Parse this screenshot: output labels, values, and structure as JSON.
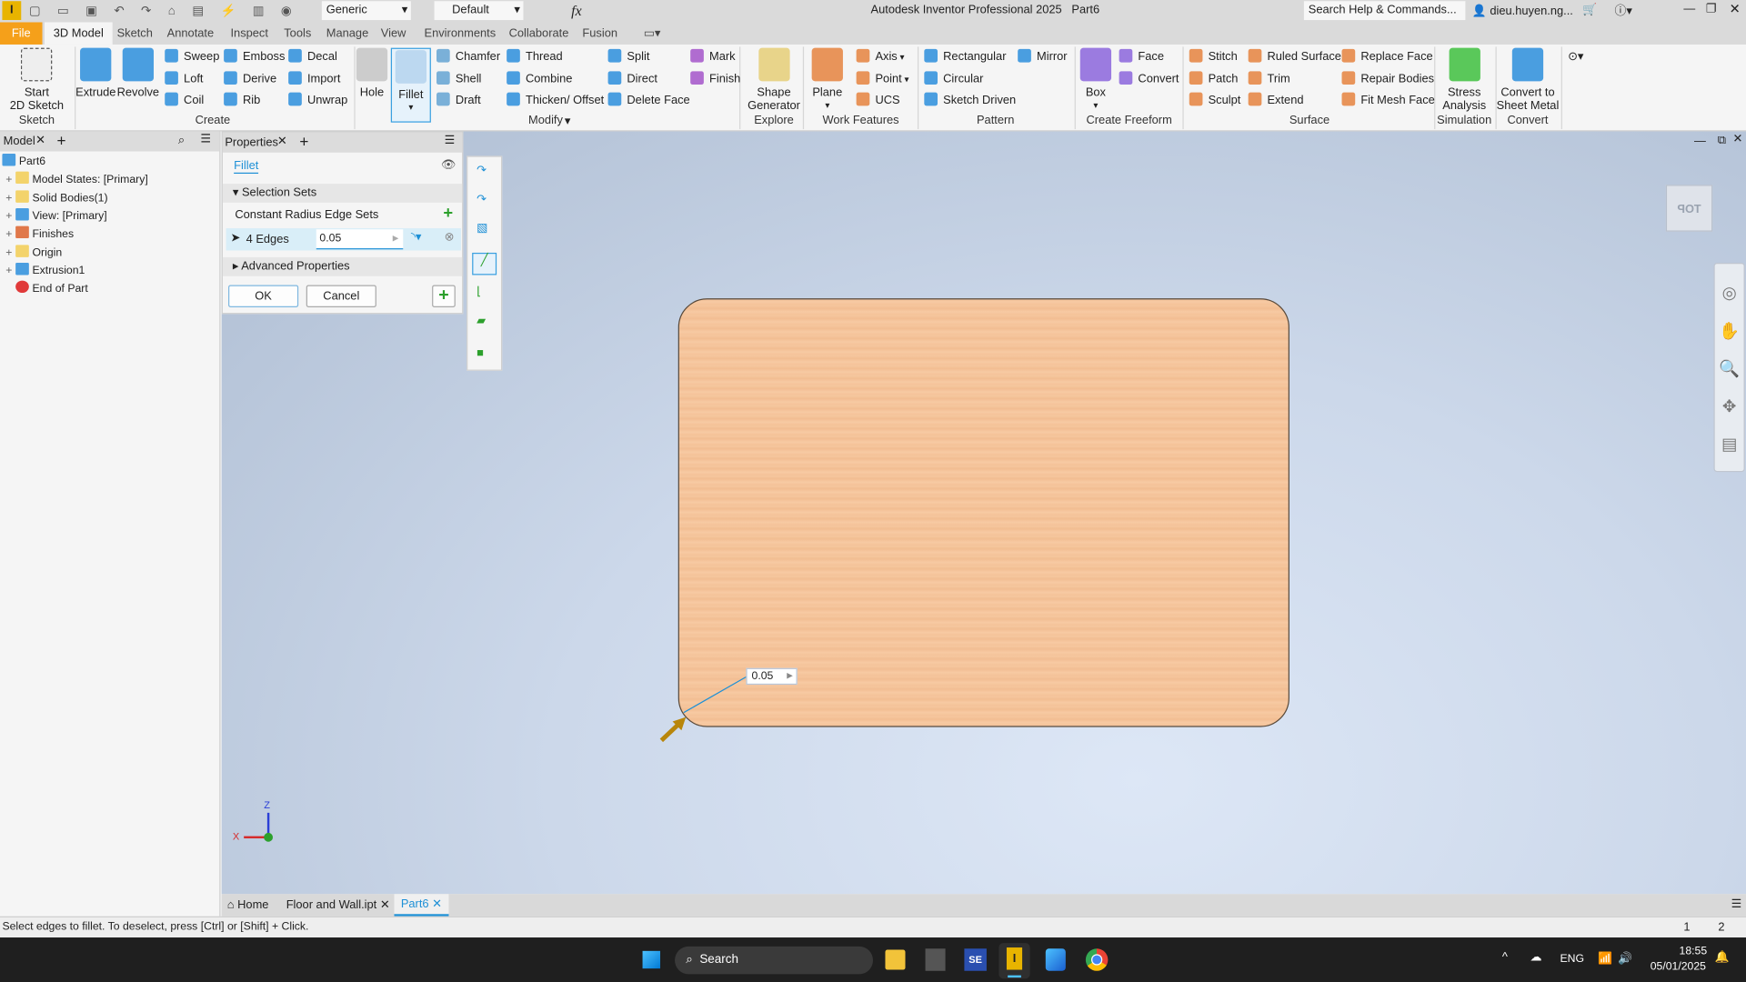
{
  "app": {
    "title": "Autodesk Inventor Professional 2025",
    "document": "Part6",
    "search_placeholder": "Search Help & Commands...",
    "user": "dieu.huyen.ng...",
    "material": "Generic",
    "appearance": "Default"
  },
  "ribbon_tabs": [
    "File",
    "3D Model",
    "Sketch",
    "Annotate",
    "Inspect",
    "Tools",
    "Manage",
    "View",
    "Environments",
    "Collaborate",
    "Fusion"
  ],
  "ribbon": {
    "groups": [
      "Sketch",
      "Create",
      "Modify",
      "Explore",
      "Work Features",
      "Pattern",
      "Create Freeform",
      "Surface",
      "Simulation",
      "Convert"
    ],
    "large": [
      "Start\n2D Sketch",
      "Extrude",
      "Revolve",
      "Hole",
      "Fillet",
      "Shape\nGenerator",
      "Plane",
      "Box",
      "Stress\nAnalysis",
      "Convert to\nSheet Metal"
    ],
    "small": [
      "Sweep",
      "Loft",
      "Coil",
      "Emboss",
      "Derive",
      "Rib",
      "Decal",
      "Import",
      "Unwrap",
      "Chamfer",
      "Shell",
      "Draft",
      "Thread",
      "Combine",
      "Thicken/ Offset",
      "Split",
      "Direct",
      "Delete Face",
      "Mark",
      "Finish",
      "Axis",
      "Point",
      "UCS",
      "Rectangular",
      "Circular",
      "Sketch Driven",
      "Mirror",
      "Face",
      "Convert",
      "Stitch",
      "Patch",
      "Sculpt",
      "Ruled Surface",
      "Trim",
      "Extend",
      "Replace Face",
      "Repair Bodies",
      "Fit Mesh Face"
    ]
  },
  "browser": {
    "tab": "Model",
    "items": [
      {
        "label": "Part6",
        "icon": "part-icon",
        "color": "#4a9ee0"
      },
      {
        "label": "Model States: [Primary]",
        "icon": "folder-icon",
        "color": "#f3d36b"
      },
      {
        "label": "Solid Bodies(1)",
        "icon": "folder-icon",
        "color": "#f3d36b"
      },
      {
        "label": "View: [Primary]",
        "icon": "view-icon",
        "color": "#4a9ee0"
      },
      {
        "label": "Finishes",
        "icon": "finishes-icon",
        "color": "#e0784a"
      },
      {
        "label": "Origin",
        "icon": "origin-icon",
        "color": "#f3d36b"
      },
      {
        "label": "Extrusion1",
        "icon": "extrusion-icon",
        "color": "#4a9ee0"
      },
      {
        "label": "End of Part",
        "icon": "end-of-part-icon",
        "color": "#e03a3a"
      }
    ]
  },
  "properties": {
    "tab": "Properties",
    "feature": "Fillet",
    "section1": "Selection Sets",
    "subsection": "Constant Radius Edge Sets",
    "edges_label": "4 Edges",
    "radius": "0.05",
    "section2": "Advanced Properties",
    "ok": "OK",
    "cancel": "Cancel"
  },
  "viewport": {
    "dimension": "0.05",
    "viewcube": "TOP",
    "axis_x": "X",
    "axis_z": "Z"
  },
  "doc_tabs": [
    "Home",
    "Floor and Wall.ipt",
    "Part6"
  ],
  "status": {
    "text": "Select edges to fillet. To deselect, press [Ctrl] or [Shift] + Click.",
    "n1": "1",
    "n2": "2"
  },
  "taskbar": {
    "search": "Search",
    "lang": "ENG",
    "time": "18:55",
    "date": "05/01/2025"
  },
  "colors": {
    "accent": "#1e90d6",
    "file_tab": "#f5a01a",
    "part": "#f4c197"
  }
}
